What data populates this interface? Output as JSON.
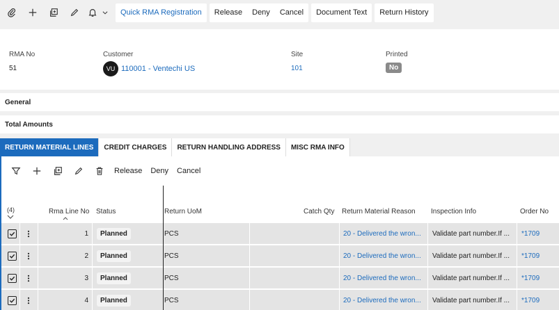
{
  "toolbar": {
    "quick_rma": "Quick RMA Registration",
    "release": "Release",
    "deny": "Deny",
    "cancel": "Cancel",
    "document_text": "Document Text",
    "return_history": "Return History"
  },
  "header": {
    "rma_no_label": "RMA No",
    "rma_no_value": "51",
    "customer_label": "Customer",
    "customer_initials": "VU",
    "customer_value": "110001 - Ventechi US",
    "site_label": "Site",
    "site_value": "101",
    "printed_label": "Printed",
    "printed_value": "No"
  },
  "sections": {
    "general": "General",
    "total_amounts": "Total Amounts"
  },
  "tabs": [
    {
      "label": "RETURN MATERIAL LINES"
    },
    {
      "label": "CREDIT CHARGES"
    },
    {
      "label": "RETURN HANDLING ADDRESS"
    },
    {
      "label": "MISC RMA INFO"
    }
  ],
  "lines_toolbar": {
    "release": "Release",
    "deny": "Deny",
    "cancel": "Cancel"
  },
  "table": {
    "count": "(4)",
    "columns": {
      "line_no": "Rma Line No",
      "status": "Status",
      "uom": "Return UoM",
      "catch_qty": "Catch Qty",
      "reason": "Return Material Reason",
      "inspection": "Inspection Info",
      "order_no": "Order No"
    },
    "rows": [
      {
        "line_no": "1",
        "status": "Planned",
        "uom": "PCS",
        "reason": "20 - Delivered the wron...",
        "inspection": "Validate part number.If ...",
        "order_no": "*1709"
      },
      {
        "line_no": "2",
        "status": "Planned",
        "uom": "PCS",
        "reason": "20 - Delivered the wron...",
        "inspection": "Validate part number.If ...",
        "order_no": "*1709"
      },
      {
        "line_no": "3",
        "status": "Planned",
        "uom": "PCS",
        "reason": "20 - Delivered the wron...",
        "inspection": "Validate part number.If ...",
        "order_no": "*1709"
      },
      {
        "line_no": "4",
        "status": "Planned",
        "uom": "PCS",
        "reason": "20 - Delivered the wron...",
        "inspection": "Validate part number.If ...",
        "order_no": "*1709"
      }
    ]
  }
}
